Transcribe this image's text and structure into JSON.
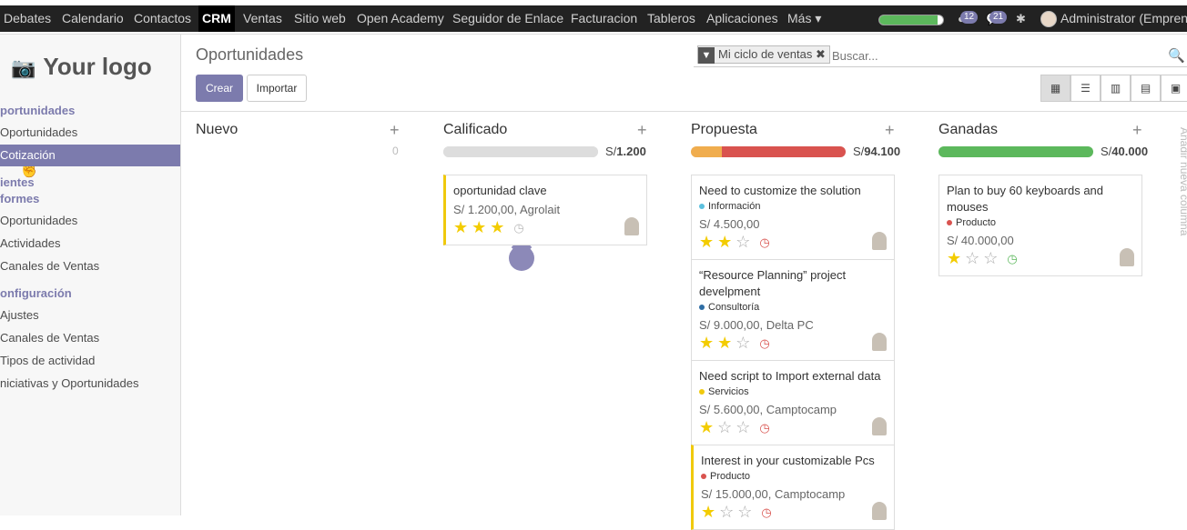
{
  "topmenu": [
    "Debates",
    "Calendario",
    "Contactos",
    "CRM",
    "Ventas",
    "Sitio web",
    "Open Academy",
    "Seguidor de Enlace",
    "Facturacion",
    "Tableros",
    "Aplicaciones",
    "Más"
  ],
  "topbar": {
    "progress": 0.92,
    "badge_activities": "12",
    "badge_messages": "21",
    "user": "Administrator (Empren..."
  },
  "sidebar": {
    "logo": "Your logo",
    "sections": [
      {
        "head": "portunidades",
        "items": [
          "Oportunidades",
          "Cotización"
        ]
      },
      {
        "head": "ientes",
        "items": []
      },
      {
        "head": "formes",
        "items": [
          "Oportunidades",
          "Actividades",
          "Canales de Ventas"
        ]
      },
      {
        "head": "onfiguración",
        "items": [
          "Ajustes",
          "Canales de Ventas",
          "Tipos de actividad",
          "niciativas y Oportunidades"
        ]
      }
    ],
    "active": "Cotización"
  },
  "control_panel": {
    "title": "Oportunidades",
    "create": "Crear",
    "import": "Importar",
    "facet": "Mi ciclo de ventas",
    "search_placeholder": "Buscar..."
  },
  "columns": [
    {
      "title": "Nuevo",
      "count": "0",
      "total": "",
      "progress": []
    },
    {
      "title": "Calificado",
      "total_prefix": "S/",
      "total": "1.200",
      "progress": [
        {
          "color": "#dddddd",
          "fraction": 1
        }
      ]
    },
    {
      "title": "Propuesta",
      "total_prefix": "S/",
      "total": "94.100",
      "progress": [
        {
          "color": "#f0ad4e",
          "fraction": 0.2
        },
        {
          "color": "#d9534f",
          "fraction": 0.8
        }
      ]
    },
    {
      "title": "Ganadas",
      "total_prefix": "S/",
      "total": "40.000",
      "progress": [
        {
          "color": "#5cb85c",
          "fraction": 1
        }
      ]
    }
  ],
  "cards": [
    {
      "column": 1,
      "title": "oportunidad clave",
      "tag": "",
      "amount": "S/ 1.200,00, Agrolait",
      "stars": 3,
      "activity": "none"
    },
    {
      "column": 2,
      "title": "Need to customize the solution",
      "tag": "Información",
      "tag_color": "#5bc0de",
      "amount": "S/ 4.500,00",
      "stars": 2,
      "activity": "overdue"
    },
    {
      "column": 2,
      "title": "“Resource Planning” project develpment",
      "tag": "Consultoría",
      "tag_color": "#2e6da4",
      "amount": "S/ 9.000,00, Delta PC",
      "stars": 2,
      "activity": "overdue"
    },
    {
      "column": 2,
      "title": "Need script to Import external data",
      "tag": "Servicios",
      "tag_color": "#f0c90d",
      "amount": "S/ 5.600,00, Camptocamp",
      "stars": 1,
      "activity": "overdue"
    },
    {
      "column": 2,
      "title": "Interest in your customizable Pcs",
      "tag": "Producto",
      "tag_color": "#d9534f",
      "amount": "S/ 15.000,00, Camptocamp",
      "stars": 1,
      "activity": "overdue"
    },
    {
      "column": 3,
      "title": "Plan to buy 60 keyboards and mouses",
      "tag": "Producto",
      "tag_color": "#d9534f",
      "amount": "S/ 40.000,00",
      "stars": 1,
      "activity": "planned"
    }
  ],
  "add_column": "Añadir nueva columna",
  "icons": {
    "search": "search-icon",
    "filter": "filter-icon",
    "camera": "camera-icon",
    "bug": "bug-icon",
    "chat": "chat-icon"
  },
  "colors": {
    "brand": "#7c7bad"
  }
}
